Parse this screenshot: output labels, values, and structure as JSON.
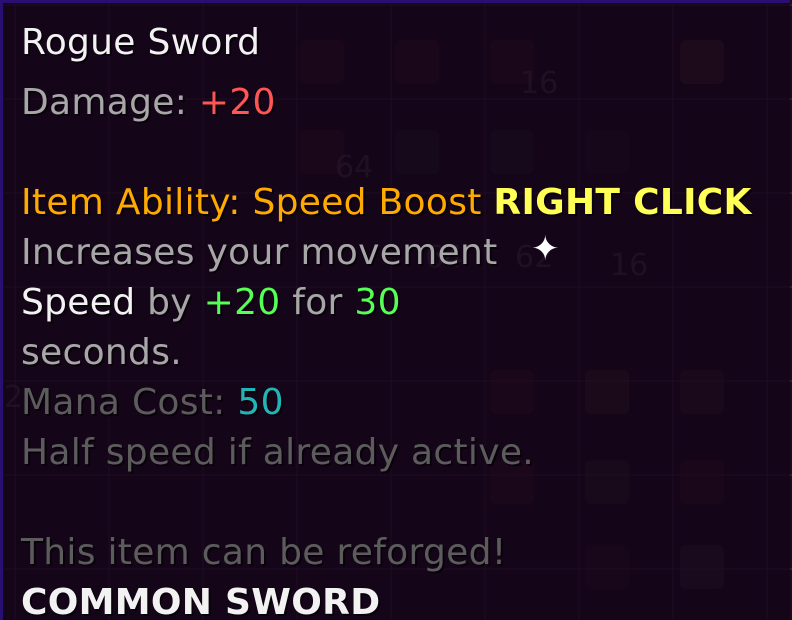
{
  "tooltip": {
    "title": "Rogue Sword",
    "damage": {
      "label": "Damage: ",
      "value": "+20"
    },
    "ability": {
      "label": "Item Ability: Speed Boost ",
      "action": "RIGHT CLICK"
    },
    "desc_line1": "Increases your movement",
    "desc_line2": {
      "stat": "Speed",
      "by": " by ",
      "amount": "+20",
      "for": " for ",
      "duration": "30"
    },
    "desc_line3": "seconds.",
    "mana": {
      "label": "Mana Cost: ",
      "value": "50"
    },
    "note": "Half speed if already active.",
    "reforge": "This item can be reforged!",
    "rarity": "COMMON SWORD"
  },
  "background_counts": [
    "16",
    "64",
    "64",
    "62",
    "16",
    "2"
  ],
  "icons": {
    "sparkle": "sparkle-icon"
  },
  "colors": {
    "red": "#ff5555",
    "gold": "#ffaa00",
    "yellow": "#ffff55",
    "green": "#55ff55",
    "aqua": "#22b5b5",
    "white": "#f2f2f2",
    "gray": "#a7a7a7"
  }
}
